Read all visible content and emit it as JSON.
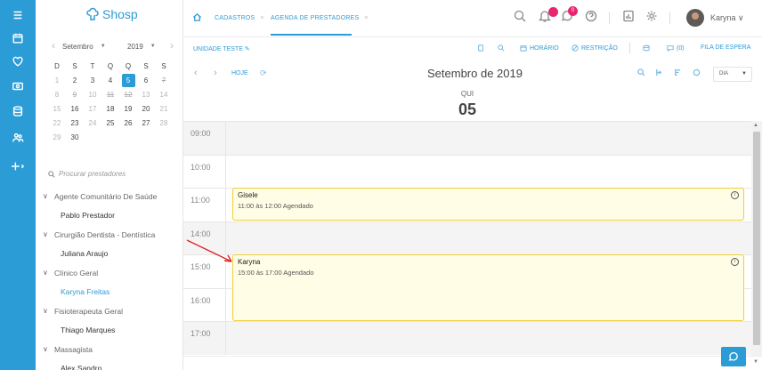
{
  "app": {
    "logo_text": "Shosp"
  },
  "tabs": [
    {
      "label": "CADASTROS"
    },
    {
      "label": "AGENDA DE PRESTADORES"
    }
  ],
  "tab_close": "×",
  "notifications": {
    "chat_count": "0"
  },
  "user": {
    "name": "Karyna"
  },
  "calendar": {
    "prev": "‹",
    "next": "›",
    "month_select": "Setembro",
    "year_select": "2019",
    "weekdays": [
      "D",
      "S",
      "T",
      "Q",
      "Q",
      "S",
      "S"
    ],
    "weeks": [
      [
        "1",
        "2",
        "3",
        "4",
        "5",
        "6",
        "7"
      ],
      [
        "8",
        "9",
        "10",
        "11",
        "12",
        "13",
        "14"
      ],
      [
        "15",
        "16",
        "17",
        "18",
        "19",
        "20",
        "21"
      ],
      [
        "22",
        "23",
        "24",
        "25",
        "26",
        "27",
        "28"
      ],
      [
        "29",
        "30",
        "",
        "",
        "",
        "",
        ""
      ]
    ]
  },
  "search": {
    "placeholder": "Procurar prestadores"
  },
  "specialties": [
    {
      "name": "Agente Comunitário De Saúde",
      "providers": [
        "Pablo Prestador"
      ]
    },
    {
      "name": "Cirurgião Dentista - Dentística",
      "providers": [
        "Juliana Araujo"
      ]
    },
    {
      "name": "Clínico Geral",
      "providers": [
        "Karyna Freitas"
      ]
    },
    {
      "name": "Fisioterapeuta Geral",
      "providers": [
        "Thiago Marques"
      ]
    },
    {
      "name": "Massagista",
      "providers": [
        "Alex Sandro"
      ]
    }
  ],
  "toolbar": {
    "unit": "UNIDADE TESTE",
    "horario": "HORÁRIO",
    "restricao": "RESTRIÇÃO",
    "messages": "(0)",
    "fila": "FILA DE ESPERA"
  },
  "nav": {
    "prev": "‹",
    "next": "›",
    "today": "HOJE",
    "month_title": "Setembro de 2019",
    "view": "DIA"
  },
  "day": {
    "weekday": "QUI",
    "number": "05"
  },
  "slots": [
    {
      "time": "09:00"
    },
    {
      "time": "10:00"
    },
    {
      "time": "11:00"
    },
    {
      "time": "14:00"
    },
    {
      "time": "15:00"
    },
    {
      "time": "16:00"
    },
    {
      "time": "17:00"
    }
  ],
  "events": [
    {
      "name": "Gisele",
      "detail": "11:00 às 12:00 Agendado"
    },
    {
      "name": "Karyna",
      "detail": "15:00 às 17:00 Agendado"
    }
  ],
  "colors": {
    "accent": "#2c9cd6",
    "event_bg": "#fffde5",
    "event_border": "#f0cf3a",
    "badge": "#e8266f"
  }
}
